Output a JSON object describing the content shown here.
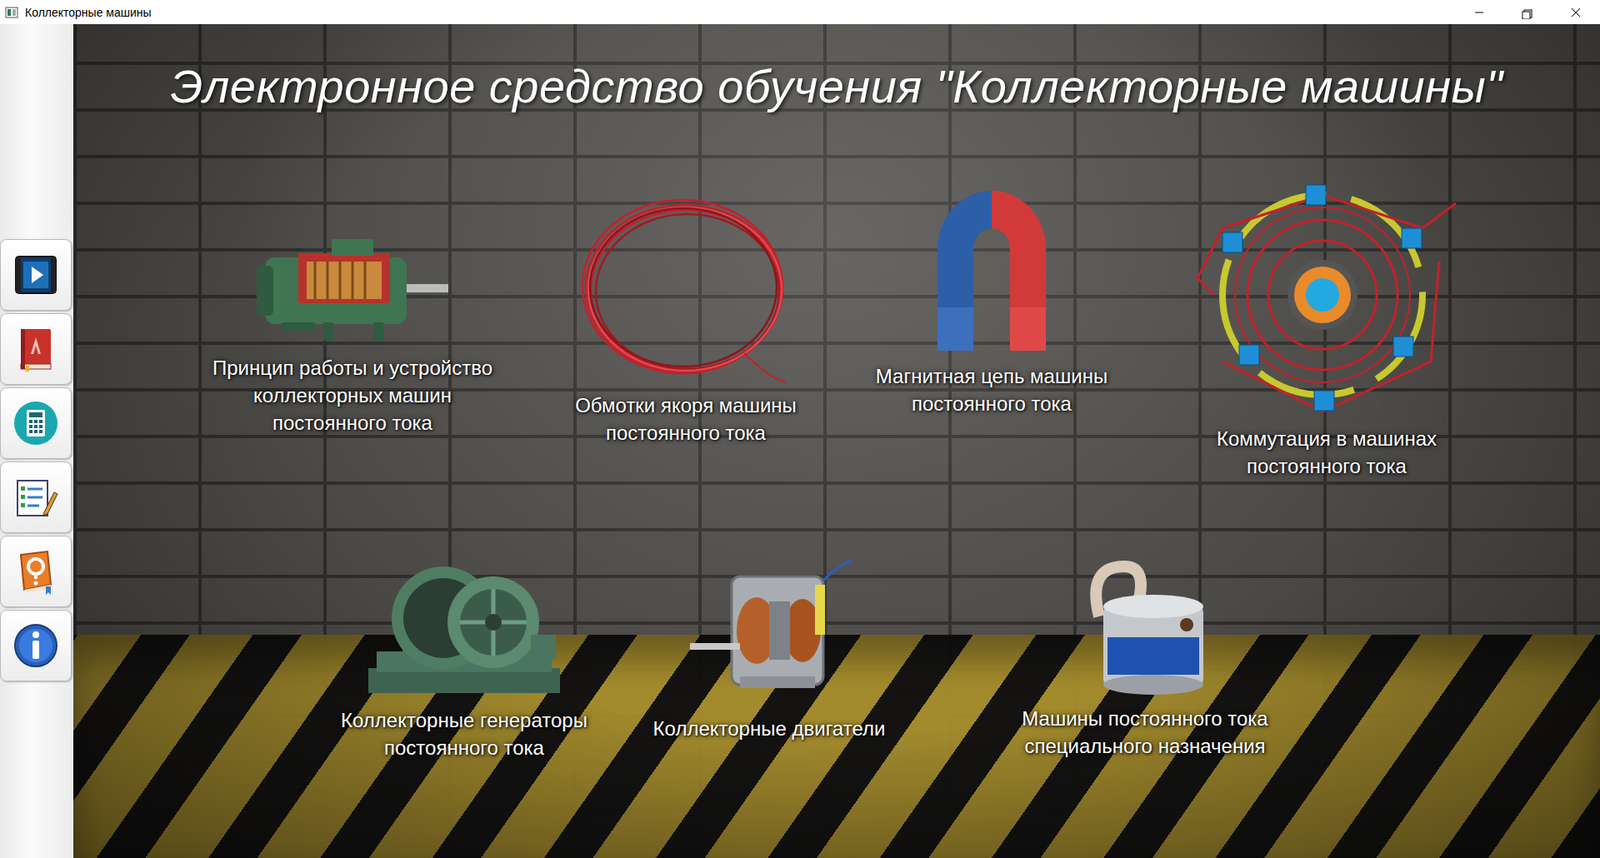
{
  "window": {
    "title": "Коллекторные машины"
  },
  "title": "Электронное средство обучения \"Коллекторные машины\"",
  "sidebar": {
    "items": [
      {
        "kind": "video"
      },
      {
        "kind": "book"
      },
      {
        "kind": "calculator"
      },
      {
        "kind": "tests"
      },
      {
        "kind": "help"
      },
      {
        "kind": "info"
      }
    ]
  },
  "sections": [
    {
      "kind": "motor",
      "lines": [
        "Принцип работы и устройство",
        "коллекторных машин",
        "постоянного тока"
      ]
    },
    {
      "kind": "coil",
      "lines": [
        "Обмотки якоря машины",
        "постоянного тока"
      ]
    },
    {
      "kind": "magnet",
      "lines": [
        "Магнитная цепь машины",
        "постоянного тока"
      ]
    },
    {
      "kind": "commutation",
      "lines": [
        "Коммутация в машинах",
        "постоянного тока"
      ]
    },
    {
      "kind": "generator",
      "lines": [
        "Коллекторные генераторы",
        "постоянного тока"
      ]
    },
    {
      "kind": "smallmotor",
      "lines": [
        "Коллекторные двигатели"
      ]
    },
    {
      "kind": "tachometer",
      "lines": [
        "Машины постоянного тока",
        "специального назначения"
      ]
    }
  ]
}
